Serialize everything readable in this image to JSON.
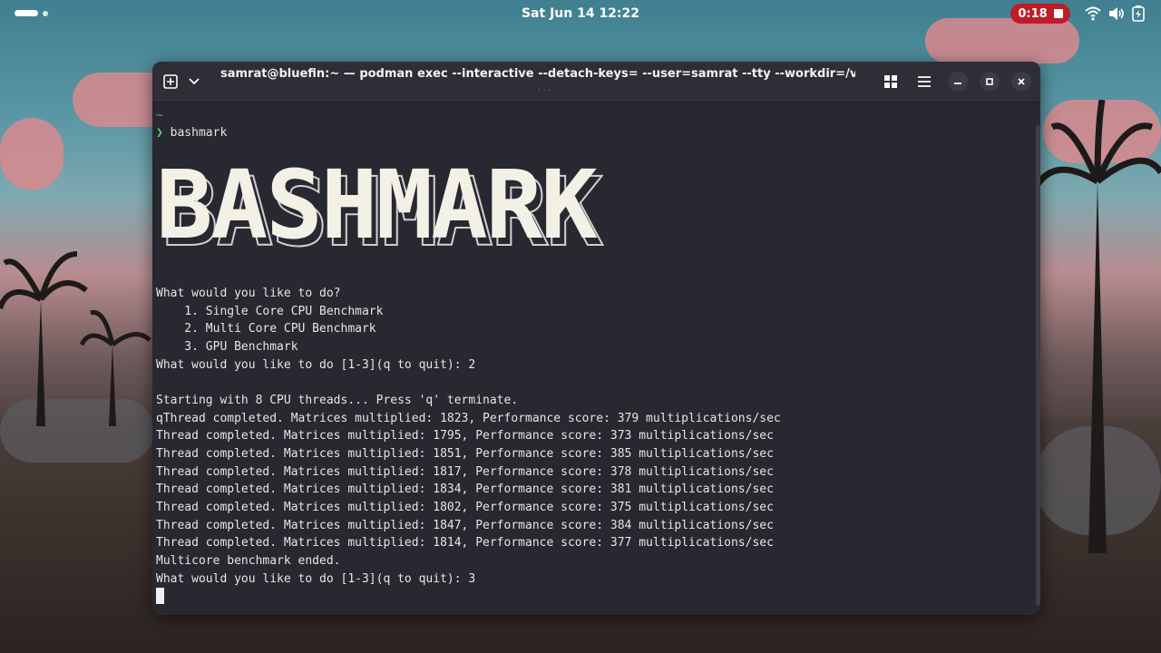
{
  "topbar": {
    "clock": "Sat Jun 14  12:22",
    "recording_time": "0:18",
    "icons": [
      "wifi-icon",
      "volume-icon",
      "battery-icon"
    ]
  },
  "window": {
    "title": "samrat@bluefin:~ — podman exec --interactive --detach-keys= --user=samrat --tty --workdir=/var/home/s..."
  },
  "terminal": {
    "cwd": "~",
    "prompt_symbol": "❯",
    "command": "bashmark",
    "banner": "BASHMARK",
    "lines": [
      "What would you like to do?",
      "    1. Single Core CPU Benchmark",
      "    2. Multi Core CPU Benchmark",
      "    3. GPU Benchmark",
      "What would you like to do [1-3](q to quit): 2",
      "",
      "Starting with 8 CPU threads... Press 'q' terminate.",
      "qThread completed. Matrices multiplied: 1823, Performance score: 379 multiplications/sec",
      "Thread completed. Matrices multiplied: 1795, Performance score: 373 multiplications/sec",
      "Thread completed. Matrices multiplied: 1851, Performance score: 385 multiplications/sec",
      "Thread completed. Matrices multiplied: 1817, Performance score: 378 multiplications/sec",
      "Thread completed. Matrices multiplied: 1834, Performance score: 381 multiplications/sec",
      "Thread completed. Matrices multiplied: 1802, Performance score: 375 multiplications/sec",
      "Thread completed. Matrices multiplied: 1847, Performance score: 384 multiplications/sec",
      "Thread completed. Matrices multiplied: 1814, Performance score: 377 multiplications/sec",
      "Multicore benchmark ended.",
      "What would you like to do [1-3](q to quit): 3"
    ]
  },
  "colors": {
    "terminal_bg": "#272830",
    "titlebar_bg": "#2d2e36",
    "prompt_green": "#5fd35f",
    "record_red": "#c01c28"
  }
}
